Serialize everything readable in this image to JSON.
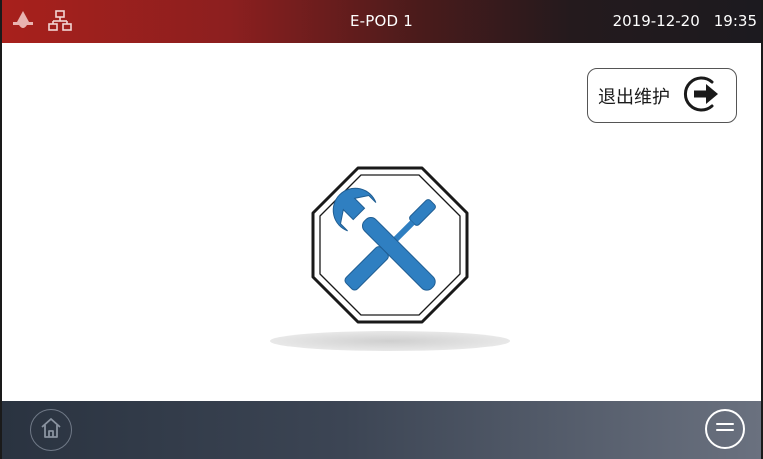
{
  "header": {
    "title": "E-POD 1",
    "date": "2019-12-20",
    "time": "19:35",
    "alert_icon": "alarm-icon",
    "network_icon": "network-icon"
  },
  "main": {
    "exit_button": {
      "label": "退出维护",
      "icon": "exit-arrow-icon"
    },
    "illustration_icon": "maintenance-tools-icon"
  },
  "footer": {
    "home_icon": "home-icon",
    "menu_icon": "menu-icon"
  },
  "colors": {
    "header_red": "#a8201c",
    "tool_blue": "#2f7fc1",
    "footer_dark": "#2a3340"
  }
}
